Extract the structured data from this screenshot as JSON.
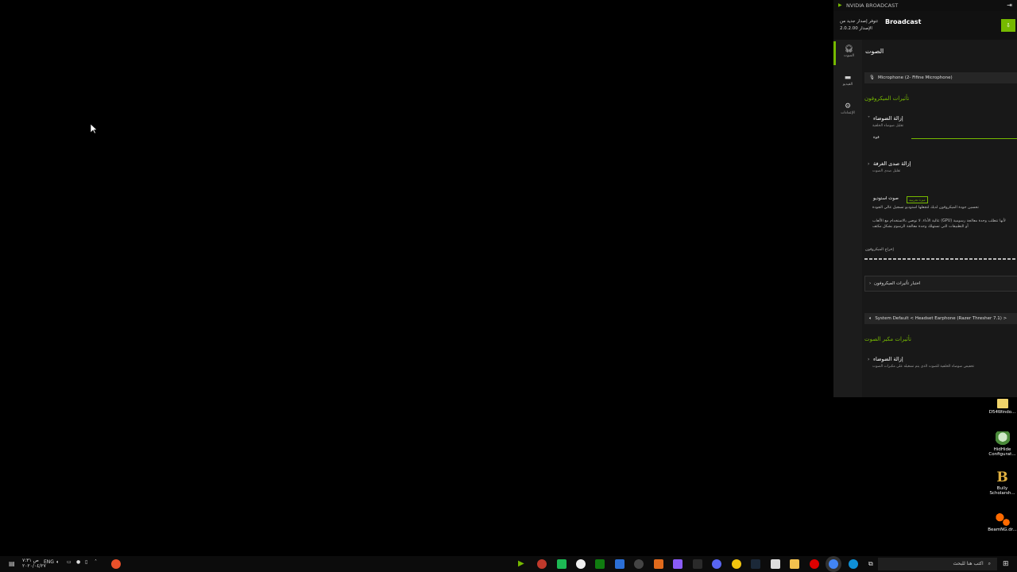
{
  "window": {
    "title": "NVIDIA BROADCAST",
    "brand": "Broadcast",
    "update_line1": "تتوفر إصدار جديد من",
    "update_line2": "الإصدار 2.0.2.00"
  },
  "sidebar": {
    "items": [
      {
        "label": "الصوت",
        "icon": "headset-icon"
      },
      {
        "label": "الفيديو",
        "icon": "camera-icon"
      },
      {
        "label": "الإعدادات",
        "icon": "gear-icon"
      }
    ]
  },
  "main": {
    "section_title": "الصوت",
    "mic_device": "Microphone (2- Fifine Microphone)",
    "mic_effects_title": "تأثيرات الميكروفون",
    "noise_removal_title": "إزالة الضوضاء",
    "noise_removal_sub": "تقليل ضوضاء الخلفية",
    "strength_label": "قوة",
    "echo_removal_title": "إزالة صدى الغرفة",
    "echo_removal_sub": "تقليل صدى الصوت",
    "studio_voice_title": "صوت استوديو",
    "studio_voice_badge": "ميزة تجريبية",
    "studio_voice_sub": "تحسين جودة الميكروفون لديك لتجعلها استوديو تسجيل عالي الجودة",
    "gpu_note_1": "عالية الأداء. لا نوصي بالاستخدام مع الألعاب (GPU) لأنها تتطلب وحدة معالجة رسومية",
    "gpu_note_2": "أو التطبيقات التي تستهلك وحدة معالجة الرسوم بشكل مكثف",
    "mic_output_label": "إخراج الميكروفون",
    "test_mic_button": "اختبار تأثيرات الميكروفون",
    "speaker_device": "System Default < Headset Earphone (Razer Thresher 7.1) >",
    "speaker_effects_title": "تأثيرات مكبر الصوت",
    "speaker_noise_title": "إزالة الضوضاء",
    "speaker_noise_sub": "تخفيض ضوضاء الخلفية للصوت الذي يتم تشغيله على مكبرات الصوت"
  },
  "desktop_icons": [
    {
      "label": "D54Windo...",
      "icon": "folder-icon"
    },
    {
      "label": "HidHide Configurat...",
      "icon": "app-icon"
    },
    {
      "label": "Bully Scholarsh...",
      "icon": "bully-icon"
    },
    {
      "label": "BeamNG.dr...",
      "icon": "beamng-icon"
    }
  ],
  "taskbar": {
    "search_placeholder": "اكتب هنا للبحث",
    "lang": "ENG",
    "time": "ص ٧:٣١",
    "date": "٢٠٢٠/٠٤/٢٧"
  }
}
